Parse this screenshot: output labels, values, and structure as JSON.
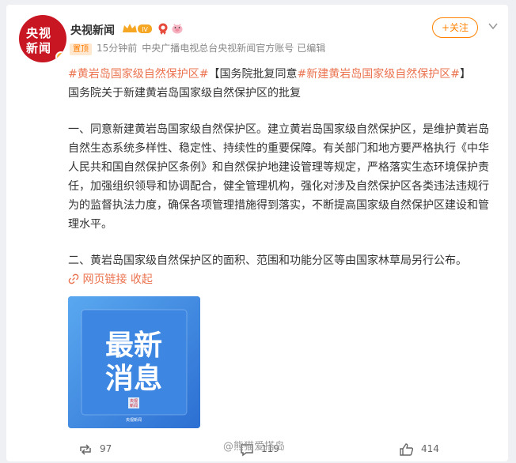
{
  "author": {
    "name": "央视新闻",
    "avatar_line1": "央视",
    "avatar_line2": "新闻",
    "level_badge": "IV"
  },
  "meta": {
    "pin_label": "置顶",
    "time": "15分钟前",
    "source": "中央广播电视总台央视新闻官方账号",
    "edited": "已编辑"
  },
  "follow_label": "+关注",
  "post": {
    "tag1": "#黄岩岛国家级自然保护区#",
    "bracket_open": "【国务院批复同意",
    "tag2": "#新建黄岩岛国家级自然保护区#",
    "bracket_close": "】",
    "line2": "国务院关于新建黄岩岛国家级自然保护区的批复",
    "para1": "一、同意新建黄岩岛国家级自然保护区。建立黄岩岛国家级自然保护区，是维护黄岩岛自然生态系统多样性、稳定性、持续性的重要保障。有关部门和地方要严格执行《中华人民共和国自然保护区条例》和自然保护地建设管理等规定，严格落实生态环境保护责任，加强组织领导和协调配合，健全管理机构，强化对涉及自然保护区各类违法违规行为的监督执法力度，确保各项管理措施得到落实，不断提高国家级自然保护区建设和管理水平。",
    "para2": "二、黄岩岛国家级自然保护区的面积、范围和功能分区等由国家林草局另行公布。",
    "link_text": "网页链接",
    "collapse_text": "收起"
  },
  "image": {
    "line1": "最新",
    "line2": "消息",
    "logo_text1": "央视",
    "logo_text2": "新闻",
    "brand_small": "央视新闻"
  },
  "footer": {
    "repost_count": "97",
    "comment_count": "119",
    "like_count": "414"
  },
  "watermark": "@熊猫爱搭岛",
  "colors": {
    "accent": "#ff8200",
    "tag": "#eb7350",
    "brand_red": "#c81623",
    "image_blue": "#3f8ae0"
  }
}
